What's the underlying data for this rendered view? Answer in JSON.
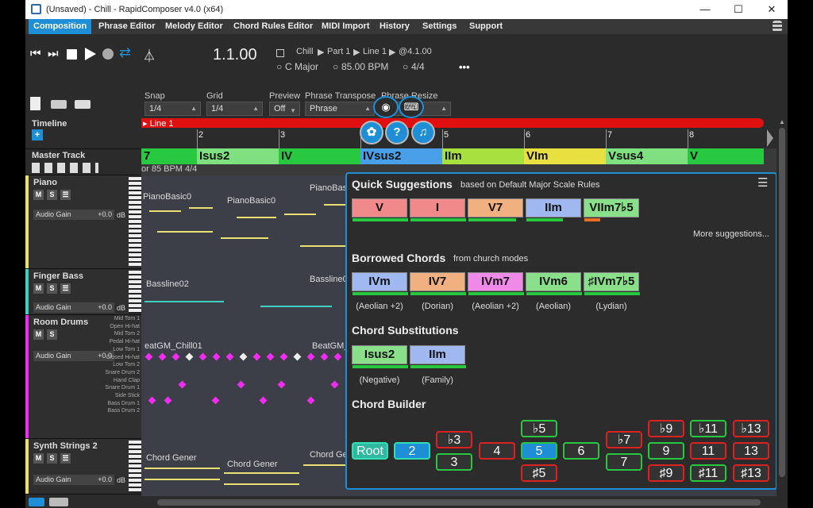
{
  "window": {
    "title": "(Unsaved) - Chill - RapidComposer v4.0 (x64)",
    "min": "—",
    "max": "☐",
    "close": "✕"
  },
  "menu": [
    "Composition",
    "Phrase Editor",
    "Melody Editor",
    "Chord Rules Editor",
    "MIDI Import",
    "History",
    "Settings",
    "Support"
  ],
  "transport": {
    "position": "1.1.00",
    "crumb1": "Chill",
    "crumb2": "Part 1",
    "crumb3": "Line 1",
    "crumb4": "@4.1.00",
    "key": "C Major",
    "tempo": "85.00 BPM",
    "meter": "4/4",
    "more": "•••"
  },
  "toolbar": {
    "snap_label": "Snap",
    "snap_value": "1/4",
    "grid_label": "Grid",
    "grid_value": "1/4",
    "preview_label": "Preview",
    "preview_value": "Off",
    "transpose_label": "Phrase Transpose",
    "transpose_value": "Phrase",
    "resize_label": "Phrase Resize"
  },
  "left": {
    "timeline": "Timeline",
    "add": "+",
    "master": "Master Track",
    "master_info": "or  85 BPM  4/4"
  },
  "tracks": [
    {
      "name": "Piano",
      "color": "#e8e070",
      "gain_label": "Audio Gain",
      "gain_value": "+0.0",
      "db": "dB"
    },
    {
      "name": "Finger Bass",
      "color": "#40d0c0",
      "gain_label": "Audio Gain",
      "gain_value": "+0.0",
      "db": "dB"
    },
    {
      "name": "Room Drums",
      "color": "#f02cf0",
      "gain_label": "Audio Gain",
      "gain_value": "+0.0",
      "db": "dB"
    },
    {
      "name": "Synth Strings 2",
      "color": "#e8e070",
      "gain_label": "Audio Gain",
      "gain_value": "+0.0",
      "db": "dB"
    }
  ],
  "drum_labels": [
    "Mid Tom 1",
    "Open Hi-hat",
    "Mid Tom 2",
    "Pedal Hi-hat",
    "Low Tom 1",
    "Closed Hi-hat",
    "Low Tom 2",
    "Snare Drum 2",
    "Hand Clap",
    "Snare Drum 1",
    "Side Stick",
    "Bass Drum 1",
    "Bass Drum 2"
  ],
  "ruler": {
    "line": "▸ Line 1",
    "bars": [
      "2",
      "3",
      "4",
      "5",
      "6",
      "7",
      "8"
    ]
  },
  "chords": [
    {
      "label": "7",
      "color": "#28c840"
    },
    {
      "label": "Isus2",
      "color": "#7fe07f"
    },
    {
      "label": "IV",
      "color": "#28c840"
    },
    {
      "label": "IVsus2",
      "color": "#4aa0e8"
    },
    {
      "label": "IIm",
      "color": "#a8e040"
    },
    {
      "label": "VIm",
      "color": "#e8e040"
    },
    {
      "label": "Vsus4",
      "color": "#7fe07f"
    },
    {
      "label": "V",
      "color": "#28c840"
    }
  ],
  "clips": {
    "piano1": "PianoBasic0",
    "piano2": "PianoBasic0",
    "piano3": "PianoBas",
    "bass1": "Bassline02",
    "bass2": "Bassline0",
    "drum1": "eatGM_Chill01",
    "drum2": "BeatGM_Ch",
    "str1": "Chord Gener",
    "str2": "Chord Gener",
    "str3": "Chord Gener"
  },
  "popup": {
    "quick_title": "Quick Suggestions",
    "quick_sub": "based on  Default Major Scale Rules",
    "quick": [
      {
        "label": "V",
        "color": "#f08a8a",
        "ul": "#28c840"
      },
      {
        "label": "I",
        "color": "#f08a8a",
        "ul": "#28c840"
      },
      {
        "label": "V7",
        "color": "#f0b080",
        "ul": "#28c840"
      },
      {
        "label": "IIm",
        "color": "#9fb8f0",
        "ul": "#28c840"
      },
      {
        "label": "VIIm7♭5",
        "color": "#8ae08a",
        "ul": "#e87020"
      }
    ],
    "more": "More suggestions...",
    "borrowed_title": "Borrowed Chords",
    "borrowed_sub": "from  church modes",
    "borrowed": [
      {
        "label": "IVm",
        "color": "#9fb8f0",
        "note": "(Aeolian +2)"
      },
      {
        "label": "IV7",
        "color": "#f0b080",
        "note": "(Dorian)"
      },
      {
        "label": "IVm7",
        "color": "#f08ae8",
        "note": "(Aeolian +2)"
      },
      {
        "label": "IVm6",
        "color": "#8ae08a",
        "note": "(Aeolian)"
      },
      {
        "label": "♯IVm7♭5",
        "color": "#8ae08a",
        "note": "(Lydian)"
      }
    ],
    "subs_title": "Chord Substitutions",
    "subs": [
      {
        "label": "Isus2",
        "color": "#8ae08a",
        "note": "(Negative)"
      },
      {
        "label": "IIm",
        "color": "#9fb8f0",
        "note": "(Family)"
      }
    ],
    "builder_title": "Chord Builder",
    "builder": {
      "root": "Root",
      "two": "2",
      "b3": "♭3",
      "three": "3",
      "four": "4",
      "b5": "♭5",
      "five": "5",
      "s5": "♯5",
      "six": "6",
      "b7": "♭7",
      "seven": "7",
      "b9": "♭9",
      "nine": "9",
      "s9": "♯9",
      "b11": "♭11",
      "eleven": "11",
      "s11": "♯11",
      "b13": "♭13",
      "thirteen": "13",
      "s13": "♯13"
    },
    "menu_icon": "☰"
  },
  "colors": {
    "accent": "#1e8fd6",
    "timeline": "#e01010",
    "green": "#28c840",
    "red": "#e02020"
  }
}
